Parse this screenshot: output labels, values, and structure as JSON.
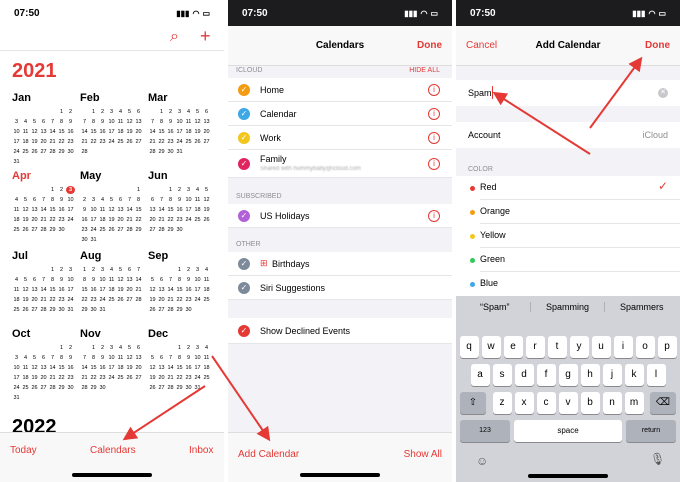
{
  "status": {
    "time": "07:50"
  },
  "panel1": {
    "year": "2021",
    "next_year": "2022",
    "weekday_offsets": [
      5,
      1,
      1,
      4,
      6,
      2,
      4,
      0,
      3,
      5,
      1,
      3
    ],
    "month_lengths": [
      31,
      28,
      31,
      30,
      31,
      30,
      31,
      31,
      30,
      31,
      30,
      31
    ],
    "months": [
      "Jan",
      "Feb",
      "Mar",
      "Apr",
      "May",
      "Jun",
      "Jul",
      "Aug",
      "Sep",
      "Oct",
      "Nov",
      "Dec"
    ],
    "highlight_month": 3,
    "highlight_day": 3,
    "tabs": {
      "today": "Today",
      "calendars": "Calendars",
      "inbox": "Inbox"
    }
  },
  "panel2": {
    "title": "Calendars",
    "done": "Done",
    "icloud_header": "ICLOUD",
    "hide_all": "HIDE ALL",
    "icloud_items": [
      {
        "label": "Home",
        "color": "#f39c12"
      },
      {
        "label": "Calendar",
        "color": "#3ea8e6"
      },
      {
        "label": "Work",
        "color": "#f3c61c"
      },
      {
        "label": "Family",
        "color": "#e0245e",
        "sub": "Shared with hummybaby@icloud.com"
      }
    ],
    "subscribed_header": "SUBSCRIBED",
    "subscribed_items": [
      {
        "label": "US Holidays",
        "color": "#b160d8"
      }
    ],
    "other_header": "OTHER",
    "other_items": [
      {
        "label": "Birthdays",
        "color": "#7d8a99"
      },
      {
        "label": "Siri Suggestions",
        "color": "#7d8a99"
      }
    ],
    "declined": {
      "label": "Show Declined Events",
      "color": "#e53935"
    },
    "add_calendar": "Add Calendar",
    "show_all": "Show All"
  },
  "panel3": {
    "cancel": "Cancel",
    "title": "Add Calendar",
    "done": "Done",
    "name_value": "Spam",
    "account_label": "Account",
    "account_value": "iCloud",
    "color_header": "COLOR",
    "colors": [
      {
        "label": "Red",
        "color": "#e53935"
      },
      {
        "label": "Orange",
        "color": "#f39c12"
      },
      {
        "label": "Yellow",
        "color": "#f3c61c"
      },
      {
        "label": "Green",
        "color": "#34c759"
      },
      {
        "label": "Blue",
        "color": "#3ea8e6"
      }
    ],
    "suggestions": [
      "“Spam”",
      "Spamming",
      "Spammers"
    ],
    "keyboard_rows": [
      [
        "q",
        "w",
        "e",
        "r",
        "t",
        "y",
        "u",
        "i",
        "o",
        "p"
      ],
      [
        "a",
        "s",
        "d",
        "f",
        "g",
        "h",
        "j",
        "k",
        "l"
      ],
      [
        "z",
        "x",
        "c",
        "v",
        "b",
        "n",
        "m"
      ]
    ],
    "key_123": "123",
    "key_space": "space",
    "key_return": "return"
  }
}
